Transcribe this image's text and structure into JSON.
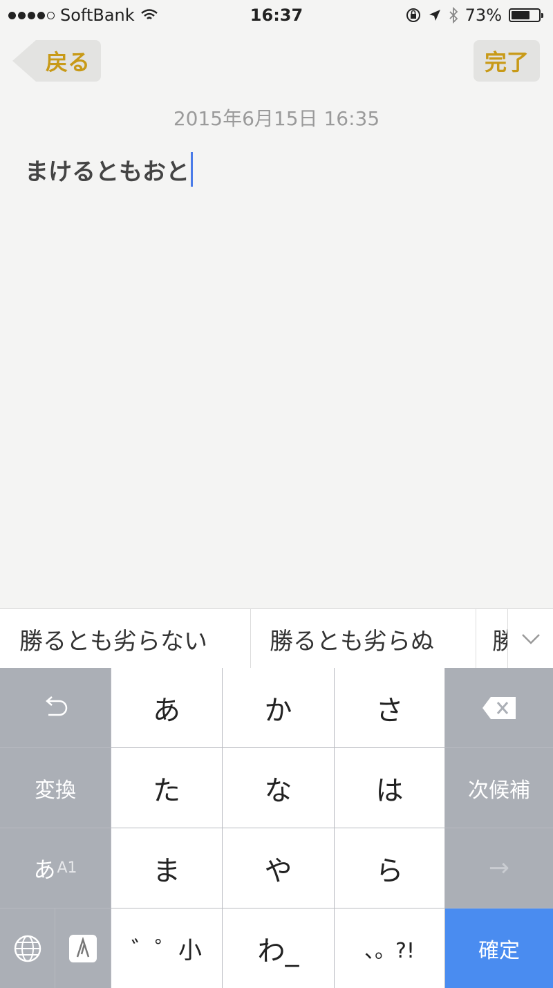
{
  "status_bar": {
    "carrier": "SoftBank",
    "time": "16:37",
    "battery": "73%",
    "battery_level": 0.73
  },
  "nav": {
    "back_label": "戻る",
    "done_label": "完了"
  },
  "note": {
    "date": "2015年6月15日 16:35",
    "text": "まけるともおと"
  },
  "suggestions": [
    "勝るとも劣らない",
    "勝るとも劣らぬ",
    "勝"
  ],
  "keyboard": {
    "undo": "↺",
    "convert": "変換",
    "mode_kana": "あ",
    "mode_alpha": "A1",
    "kana_row1": [
      "あ",
      "か",
      "さ"
    ],
    "kana_row2": [
      "た",
      "な",
      "は"
    ],
    "kana_row3": [
      "ま",
      "や",
      "ら"
    ],
    "dakuten": "゛゜小",
    "wa": "わ_",
    "punct": "、。?!",
    "next_candidate": "次候補",
    "arrow": "→",
    "confirm": "確定",
    "globe": "🌐"
  },
  "colors": {
    "accent_gold": "#c89a18",
    "confirm_blue": "#4a8cf0",
    "caret_blue": "#4a7be8"
  }
}
